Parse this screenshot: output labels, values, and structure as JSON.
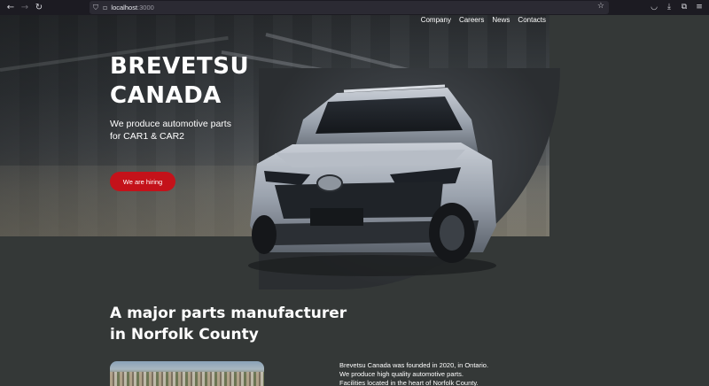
{
  "browser": {
    "url_host": "localhost",
    "url_port": ":3000"
  },
  "nav": {
    "items": [
      "Company",
      "Careers",
      "News",
      "Contacts"
    ]
  },
  "hero": {
    "brand_line1": "BREVETSU",
    "brand_line2": "CANADA",
    "tagline": "We produce automotive parts for CAR1 & CAR2",
    "cta_label": "We are hiring"
  },
  "section": {
    "title_line1": "A major parts manufacturer",
    "title_line2": "in Norfolk County",
    "about_lines": [
      "Brevetsu Canada was founded in 2020, in Ontario.",
      "We produce high quality automotive parts.",
      "Facilities located in the heart of Norfolk County."
    ]
  },
  "colors": {
    "page_bg": "#343837",
    "cta_bg": "#c4121a",
    "text": "#ffffff"
  }
}
